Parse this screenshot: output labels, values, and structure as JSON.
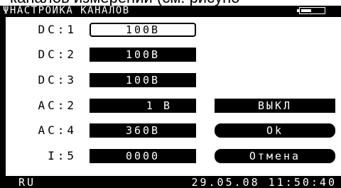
{
  "caption_fragment": "каналов измерений (см. рисуно",
  "header": {
    "title": "ΨНАСТРОЙКА КАНАЛОВ",
    "battery_level": 0.45
  },
  "rows": [
    {
      "label": "DC:1",
      "value": "100В",
      "selected": true
    },
    {
      "label": "DC:2",
      "value": "100В"
    },
    {
      "label": "DC:3",
      "value": "100В"
    },
    {
      "label": "AC:2",
      "value": "1 В"
    },
    {
      "label": "AC:4",
      "value": "360В"
    },
    {
      "label": "I:5",
      "value": "0000"
    }
  ],
  "buttons": {
    "off": "ВЫКЛ",
    "ok": "Ok",
    "cancel": "Отмена"
  },
  "status": {
    "lang": "RU",
    "datetime": "29.05.08 11:50:40"
  }
}
